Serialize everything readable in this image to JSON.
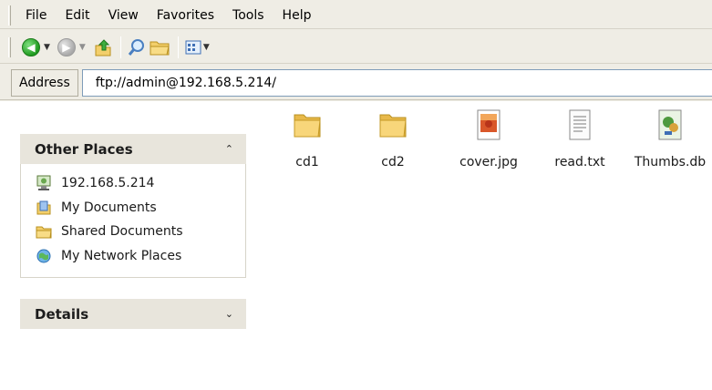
{
  "menubar": {
    "items": [
      "File",
      "Edit",
      "View",
      "Favorites",
      "Tools",
      "Help"
    ]
  },
  "toolbar": {
    "icons": [
      "back-icon",
      "forward-icon",
      "up-folder-icon",
      "search-icon",
      "folders-icon",
      "views-icon"
    ]
  },
  "address": {
    "label": "Address",
    "value": "ftp://admin@192.168.5.214/"
  },
  "sidebar": {
    "other_places": {
      "title": "Other Places",
      "items": [
        {
          "label": "192.168.5.214",
          "icon": "ftp-site-icon"
        },
        {
          "label": "My Documents",
          "icon": "my-documents-icon"
        },
        {
          "label": "Shared Documents",
          "icon": "shared-folder-icon"
        },
        {
          "label": "My Network Places",
          "icon": "network-places-icon"
        }
      ]
    },
    "details": {
      "title": "Details"
    }
  },
  "files": [
    {
      "name": "cd1",
      "icon": "folder-icon"
    },
    {
      "name": "cd2",
      "icon": "folder-icon"
    },
    {
      "name": "cover.jpg",
      "icon": "image-file-icon"
    },
    {
      "name": "read.txt",
      "icon": "text-file-icon"
    },
    {
      "name": "Thumbs.db",
      "icon": "db-file-icon"
    }
  ],
  "colors": {
    "chrome": "#efede5",
    "panel_header": "#e8e5dc",
    "folder": "#f3cf6b"
  }
}
